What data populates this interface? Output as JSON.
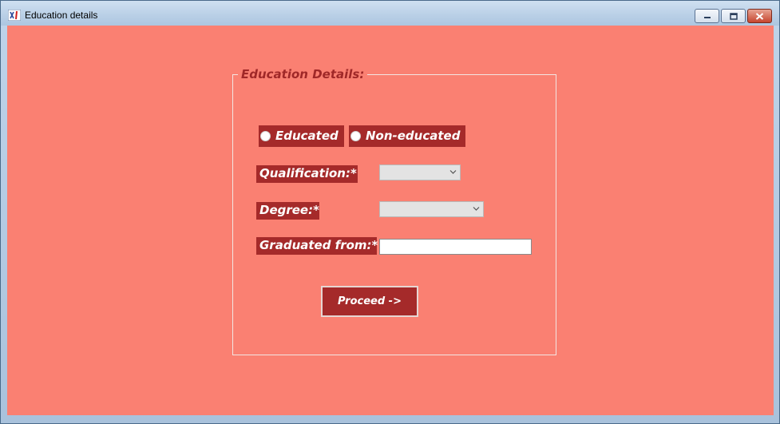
{
  "window": {
    "title": "Education details",
    "icon": "app-icon",
    "controls": {
      "minimize": "minimize-icon",
      "maximize": "maximize-icon",
      "close": "close-icon"
    }
  },
  "form": {
    "group_title": "Education Details:",
    "radios": [
      {
        "label": "Educated",
        "selected": false
      },
      {
        "label": "Non-educated",
        "selected": false
      }
    ],
    "qualification": {
      "label": "Qualification:*",
      "value": ""
    },
    "degree": {
      "label": "Degree:*",
      "value": ""
    },
    "graduated_from": {
      "label": "Graduated from:*",
      "value": ""
    },
    "proceed_label": "Proceed ->"
  },
  "colors": {
    "background": "#fa8072",
    "label_bg": "#a52a2a",
    "legend_text": "#a02828",
    "label_text": "#ffffff"
  }
}
